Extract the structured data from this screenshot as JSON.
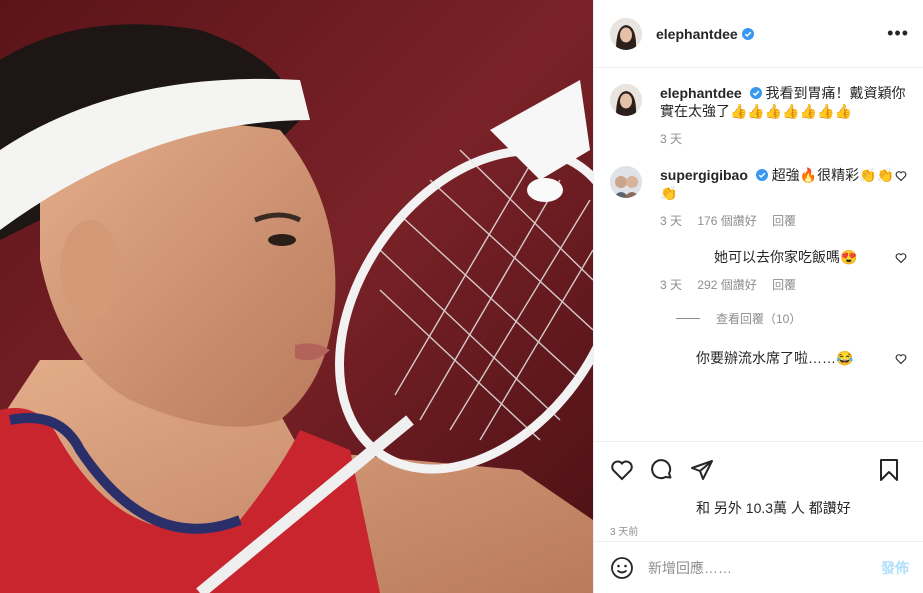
{
  "post": {
    "author": "elephantdee",
    "caption": "我看到胃痛！戴資穎你實在太強了👍👍👍👍👍👍👍",
    "caption_time": "3 天"
  },
  "comments": [
    {
      "user": "supergigibao",
      "text": "超強🔥很精彩👏👏👏",
      "time": "3 天",
      "likes": "176 個讚好",
      "reply": "回覆"
    },
    {
      "user": "",
      "text": "她可以去你家吃飯嗎😍",
      "time": "3 天",
      "likes": "292 個讚好",
      "reply": "回覆",
      "view_replies": "查看回覆（10）"
    },
    {
      "user": "",
      "text": "你要辦流水席了啦……😂"
    }
  ],
  "likes_summary": "和 另外 10.3萬 人 都讚好",
  "post_time": "3 天前",
  "add_comment": {
    "placeholder": "新增回應……",
    "post_label": "發佈"
  },
  "icons": {
    "verified": "verified-badge-icon",
    "more": "more-options-icon",
    "like": "heart-icon",
    "comment": "comment-icon",
    "share": "share-icon",
    "bookmark": "bookmark-icon",
    "emoji": "emoji-icon"
  },
  "colors": {
    "verified": "#3897f0",
    "post_button": "#b2dffc",
    "meta": "#8e8e8e"
  }
}
